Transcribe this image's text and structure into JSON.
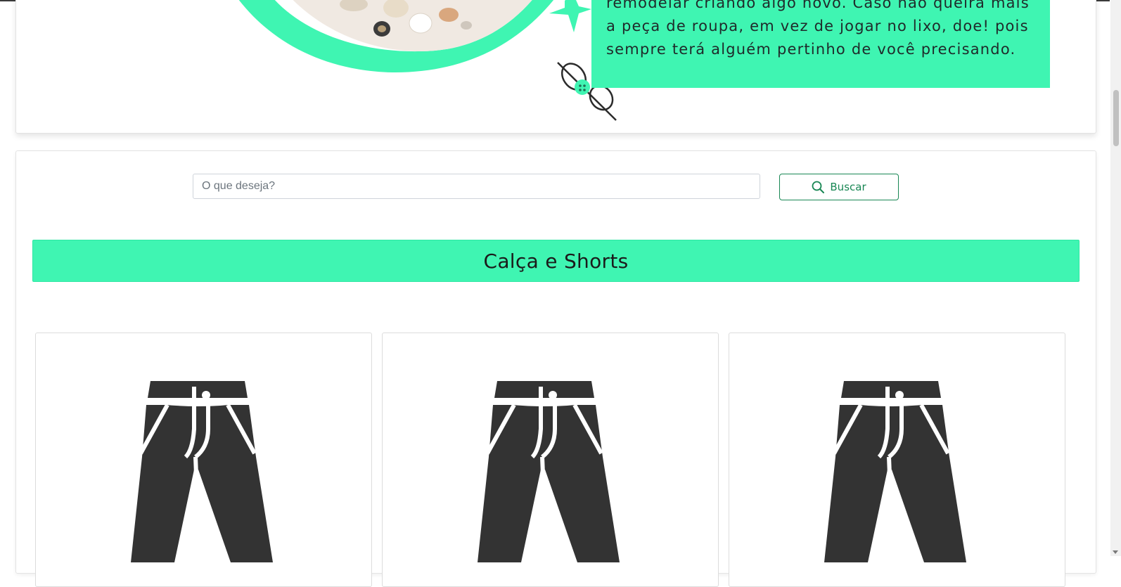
{
  "hero": {
    "text_line_1": "remodelar criando algo novo. Caso não queira mais",
    "text_line_2": "a peça de roupa, em vez de jogar no lixo, doe! pois",
    "text_line_3": "sempre terá alguém pertinho de você precisando.",
    "accent_color": "#3ff5b2"
  },
  "search": {
    "placeholder": "O que deseja?",
    "value": "",
    "button_label": "Buscar",
    "button_color": "#198754"
  },
  "category": {
    "title": "Calça e Shorts"
  },
  "products": [
    {
      "icon": "pants-icon"
    },
    {
      "icon": "pants-icon"
    },
    {
      "icon": "pants-icon"
    }
  ]
}
